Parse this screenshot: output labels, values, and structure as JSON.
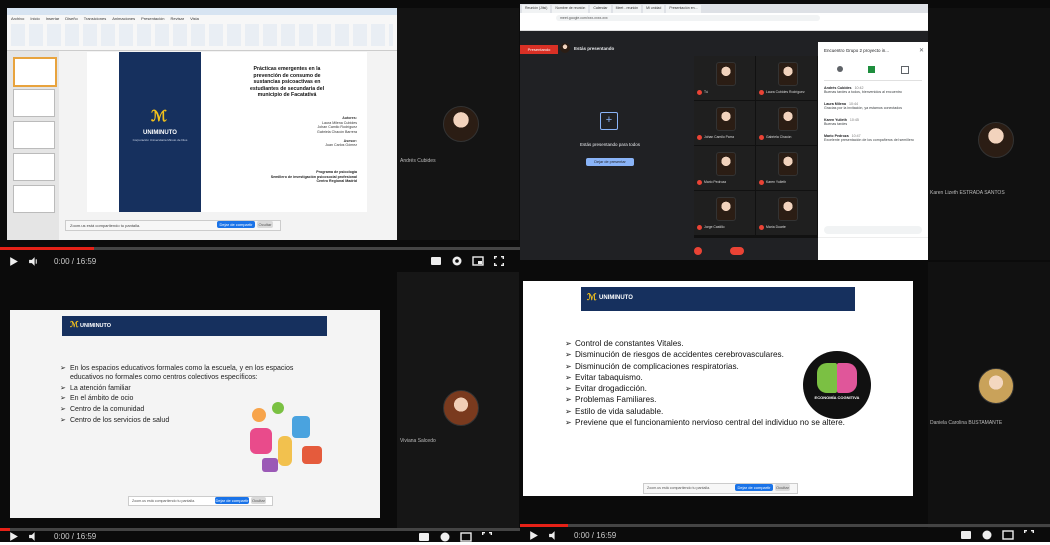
{
  "q1": {
    "ribbon_tabs": [
      "Archivo",
      "Inicio",
      "Insertar",
      "Diseño",
      "Transiciones",
      "Animaciones",
      "Presentación",
      "Revisar",
      "Vista"
    ],
    "slide": {
      "logo_text": "UNIMINUTO",
      "logo_sub": "Corporación Universitaria Minuto de Dios",
      "title_lines": [
        "Prácticas emergentes en la",
        "prevención de consumo de",
        "sustancias psicoactivas en",
        "estudiantes de secundaria del",
        "municipio de Facatativá"
      ],
      "authors_heading": "Autores:",
      "authors": [
        "Laura Milena Cubides",
        "Johan Camilo Rodríguez",
        "Gabriela Chacón Barrera"
      ],
      "advisor_heading": "Asesor:",
      "advisor": "Juan Carlos Gómez",
      "program_lines": [
        "Programa de psicología",
        "Semillero de investigación psicosocial profesional",
        "Centro Regional Madrid"
      ]
    },
    "share_notice": "Zoom.us está compartiendo tu pantalla.",
    "share_stop": "Dejar de compartir",
    "share_hide": "Ocultar",
    "time": "0:00 / 16:59",
    "camera": {
      "name": "Andrés Cubides"
    },
    "progress": 0.18
  },
  "q2": {
    "browser_tabs": [
      "Reunión (Jitsi)",
      "Nombre de reunión",
      "Calendar",
      "Meet - reunión",
      "Mi unidad",
      "Presentación en..."
    ],
    "url": "meet.google.com/xxx-xxxx-xxx",
    "banner_left": "Presentando",
    "banner_presenter": "Estás presentando",
    "presenting_label": "Estás presentando para todos",
    "stop_label": "Dejar de presentar",
    "people": [
      {
        "name": "Tú"
      },
      {
        "name": "Laura Cubides Rodríguez"
      },
      {
        "name": "Johan Camilo Parra"
      },
      {
        "name": "Gabriela Chacón"
      },
      {
        "name": "Mario Pedroza"
      },
      {
        "name": "Karen Yulieth"
      },
      {
        "name": "Jorge Castillo"
      },
      {
        "name": "María Duarte"
      }
    ],
    "chat_heading": "Encuentro Grupo 2 proyecto in...",
    "chat_messages": [
      {
        "author": "Andrés Cubides",
        "time": "10:42",
        "text": "Buenas tardes a todos, bienvenidos al encuentro"
      },
      {
        "author": "Laura Milena",
        "time": "10:44",
        "text": "Gracias por la invitación, ya estamos conectados"
      },
      {
        "author": "Karen Yulieth",
        "time": "10:45",
        "text": "Buenas tardes"
      },
      {
        "author": "Mario Pedroza",
        "time": "10:47",
        "text": "Excelente presentación de los compañeros del semillero"
      }
    ],
    "chat_placeholder": "Envía un mensaje a todos",
    "camera": {
      "name": "Karen Lizeth ESTRADA SANTOS"
    }
  },
  "q3": {
    "slide": {
      "logo_text": "UNIMINUTO",
      "bullets": [
        "En los espacios educativos formales como la escuela, y en los espacios educativos no formales como centros colectivos específicos:",
        "La atención familiar",
        "En el ámbito de ocio",
        "Centro de la comunidad",
        "Centro de los servicios de salud"
      ]
    },
    "share_notice": "Zoom.us está compartiendo tu pantalla.",
    "share_stop": "Dejar de compartir",
    "share_hide": "Ocultar",
    "camera": {
      "name": "Viviana Salcedo"
    },
    "time": "0:00 / 16:59"
  },
  "q4": {
    "slide": {
      "logo_text": "UNIMINUTO",
      "bullets": [
        "Control de constantes Vitales.",
        "Disminución de riesgos de accidentes cerebrovasculares.",
        "Disminución de complicaciones respiratorias.",
        "Evitar tabaquismo.",
        "Evitar drogadicción.",
        "Problemas Familiares.",
        "Estilo de vida saludable.",
        "Previene que el funcionamiento nervioso central del individuo no se altere."
      ],
      "badge_text": "ECONOMÍA COGNITIVA"
    },
    "share_notice": "Zoom.us está compartiendo tu pantalla.",
    "share_stop": "Dejar de compartir",
    "share_hide": "Ocultar",
    "time": "0:00 / 16:59",
    "camera": {
      "name": "Daniela Carolina BUSTAMANTE"
    }
  },
  "colors": {
    "navy": "#16305e",
    "blue_button": "#1a73e8",
    "meet_dark": "#202124",
    "progress_red": "#e62117"
  }
}
